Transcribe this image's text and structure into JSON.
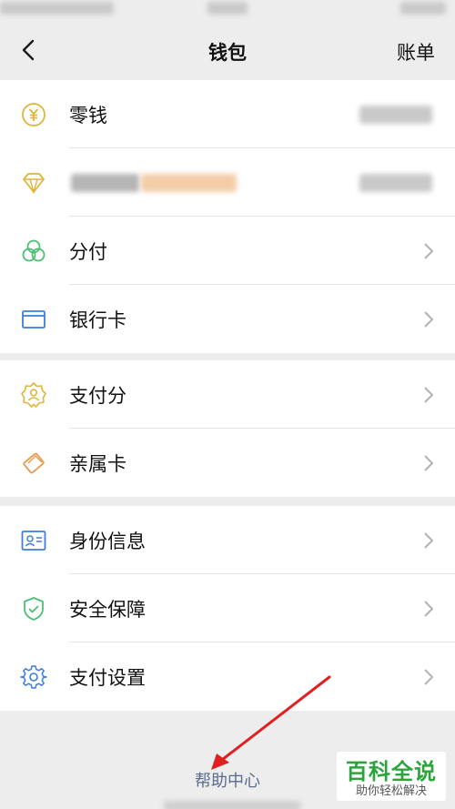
{
  "navbar": {
    "title": "钱包",
    "right_label": "账单"
  },
  "groups": [
    {
      "items": [
        {
          "label": "零钱",
          "icon": "coin-yen-icon"
        },
        {
          "label": "",
          "icon": "diamond-icon"
        },
        {
          "label": "分付",
          "icon": "fenfu-circles-icon"
        },
        {
          "label": "银行卡",
          "icon": "bank-card-icon"
        }
      ]
    },
    {
      "items": [
        {
          "label": "支付分",
          "icon": "badge-person-icon"
        },
        {
          "label": "亲属卡",
          "icon": "family-card-icon"
        }
      ]
    },
    {
      "items": [
        {
          "label": "身份信息",
          "icon": "id-card-icon"
        },
        {
          "label": "安全保障",
          "icon": "shield-check-icon"
        },
        {
          "label": "支付设置",
          "icon": "gear-icon"
        }
      ]
    }
  ],
  "footer": {
    "help_link": "帮助中心"
  },
  "watermark": {
    "title": "百科全说",
    "subtitle": "助你轻松解决"
  },
  "colors": {
    "accent_green": "#2ba53b",
    "link_blue": "#5a6d90",
    "icon_gold": "#e0b53a",
    "icon_green": "#4bbf73",
    "icon_blue": "#3d7fd6"
  }
}
